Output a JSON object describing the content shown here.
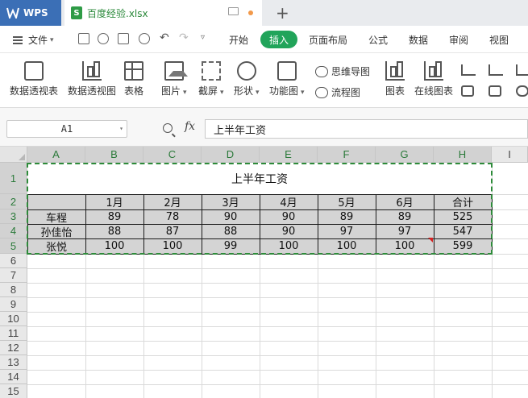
{
  "titlebar": {
    "app_tab": "WPS",
    "doc_tab": "百度经验.xlsx",
    "doc_icon_letter": "S",
    "new_tab": "+"
  },
  "menubar": {
    "file": "文件",
    "items": [
      "开始",
      "插入",
      "页面布局",
      "公式",
      "数据",
      "审阅",
      "视图"
    ],
    "active": "插入"
  },
  "ribbon": {
    "pivot_table": "数据透视表",
    "pivot_chart": "数据透视图",
    "table": "表格",
    "picture": "图片",
    "screenshot": "截屏",
    "shape": "形状",
    "function_chart": "功能图",
    "mind_map": "思维导图",
    "flowchart": "流程图",
    "chart": "图表",
    "online_chart": "在线图表"
  },
  "formula_bar": {
    "name_box": "A1",
    "fx": "fx",
    "content": "上半年工资"
  },
  "sheet": {
    "columns": [
      "A",
      "B",
      "C",
      "D",
      "E",
      "F",
      "G",
      "H",
      "I"
    ],
    "rows": [
      "1",
      "2",
      "3",
      "4",
      "5",
      "6",
      "7",
      "8",
      "9",
      "10",
      "11",
      "12",
      "13",
      "14",
      "15"
    ],
    "title": "上半年工资",
    "header": [
      "",
      "1月",
      "2月",
      "3月",
      "4月",
      "5月",
      "6月",
      "合计"
    ],
    "data": [
      [
        "车程",
        "89",
        "78",
        "90",
        "90",
        "89",
        "89",
        "525"
      ],
      [
        "孙佳怡",
        "88",
        "87",
        "88",
        "90",
        "97",
        "97",
        "547"
      ],
      [
        "张悦",
        "100",
        "100",
        "99",
        "100",
        "100",
        "100",
        "599"
      ]
    ]
  },
  "colors": {
    "accent_green": "#21a45a",
    "wps_blue": "#3b6fb6",
    "selection": "#2e8b3a"
  }
}
